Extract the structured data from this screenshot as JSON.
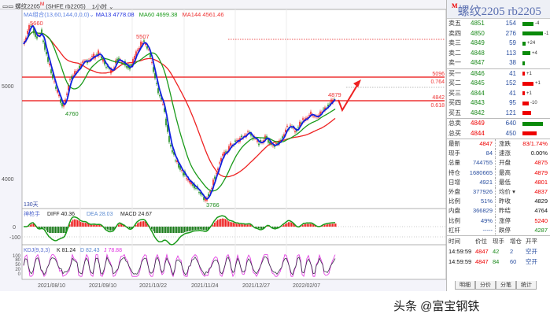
{
  "title_bar": {
    "symbol": "螺纹2205",
    "flag": "M",
    "code": "(SHFE rb2205)",
    "period": "1小时"
  },
  "main_legend": {
    "label": "MA组合(13,60,144,0,0,0)",
    "ma13": "MA13 4778.08",
    "ma60": "MA60 4699.38",
    "ma144": "MA144 4561.46"
  },
  "annotations": {
    "high1": "5660",
    "high2": "5507",
    "low1": "4760",
    "low2": "3766",
    "last_high": "4879",
    "level1": "5096",
    "ratio1": "0.764",
    "level2": "4842",
    "ratio2": "0.618",
    "days": "130天"
  },
  "price_axis": [
    "5000",
    "4000"
  ],
  "price_path": [
    [
      0,
      5450
    ],
    [
      6,
      5620
    ],
    [
      10,
      5660
    ],
    [
      16,
      5520
    ],
    [
      22,
      5580
    ],
    [
      30,
      5300
    ],
    [
      40,
      5000
    ],
    [
      50,
      4760
    ],
    [
      58,
      5050
    ],
    [
      70,
      5200
    ],
    [
      82,
      5280
    ],
    [
      95,
      5350
    ],
    [
      110,
      5150
    ],
    [
      120,
      5300
    ],
    [
      135,
      5200
    ],
    [
      145,
      5380
    ],
    [
      152,
      5507
    ],
    [
      160,
      5350
    ],
    [
      170,
      4950
    ],
    [
      178,
      4750
    ],
    [
      186,
      4350
    ],
    [
      194,
      4180
    ],
    [
      204,
      4050
    ],
    [
      212,
      3950
    ],
    [
      222,
      3880
    ],
    [
      232,
      3766
    ],
    [
      240,
      3950
    ],
    [
      250,
      4200
    ],
    [
      262,
      4350
    ],
    [
      274,
      4420
    ],
    [
      286,
      4500
    ],
    [
      298,
      4380
    ],
    [
      308,
      4440
    ],
    [
      318,
      4350
    ],
    [
      326,
      4420
    ],
    [
      336,
      4560
    ],
    [
      346,
      4520
    ],
    [
      356,
      4650
    ],
    [
      366,
      4700
    ],
    [
      374,
      4680
    ],
    [
      384,
      4760
    ],
    [
      390,
      4820
    ],
    [
      396,
      4879
    ]
  ],
  "macd_legend": {
    "label": "神枪手",
    "diff": "DIFF 40.36",
    "dea": "DEA 28.03",
    "macd": "MACD 24.67",
    "axis": [
      "0",
      "-100"
    ]
  },
  "kdj_legend": {
    "label": "KDJ(9,3,3)",
    "k": "K 81.24",
    "d": "D 82.43",
    "j": "J 78.88",
    "axis": [
      "100",
      "80",
      "50",
      "20",
      "0"
    ]
  },
  "dates": [
    "2021/08/10",
    "2021/09/10",
    "2021/10/22",
    "2021/11/24",
    "2021/12/27",
    "2022/02/07"
  ],
  "quote": {
    "name": "螺纹2205",
    "code": "rb2205",
    "flag": "M",
    "asks": [
      {
        "l": "卖五",
        "p": "4851",
        "v": "154",
        "c": "-4",
        "w": 14
      },
      {
        "l": "卖四",
        "p": "4850",
        "v": "276",
        "c": "-1",
        "w": 26
      },
      {
        "l": "卖三",
        "p": "4849",
        "v": "59",
        "c": "+24",
        "w": 4
      },
      {
        "l": "卖二",
        "p": "4848",
        "v": "113",
        "c": "+4",
        "w": 10
      },
      {
        "l": "卖一",
        "p": "4847",
        "v": "38",
        "c": "",
        "w": 3
      }
    ],
    "bids": [
      {
        "l": "买一",
        "p": "4846",
        "v": "41",
        "c": "+1",
        "w": 3
      },
      {
        "l": "买二",
        "p": "4845",
        "v": "152",
        "c": "+1",
        "w": 14
      },
      {
        "l": "买三",
        "p": "4844",
        "v": "41",
        "c": "+1",
        "w": 3
      },
      {
        "l": "买四",
        "p": "4843",
        "v": "95",
        "c": "-10",
        "w": 8
      },
      {
        "l": "买五",
        "p": "4842",
        "v": "121",
        "c": "",
        "w": 11
      }
    ],
    "totals": [
      {
        "l": "总卖",
        "p": "4849",
        "v": "640",
        "w": 26,
        "col": "#0a8a0a"
      },
      {
        "l": "总买",
        "p": "4844",
        "v": "450",
        "w": 18,
        "col": "#e00"
      }
    ],
    "stats": [
      [
        "最新",
        "4847",
        "涨跌",
        "83/1.74%",
        "red",
        "red"
      ],
      [
        "现手",
        "84",
        "速涨",
        "0.00%",
        "blu",
        "blk"
      ],
      [
        "总量",
        "744755",
        "开盘",
        "4875",
        "blu",
        "red"
      ],
      [
        "持仓",
        "1680665",
        "最高",
        "4879",
        "blu",
        "red"
      ],
      [
        "日增",
        "4921",
        "最低",
        "4801",
        "blu",
        "red"
      ],
      [
        "外盘",
        "377926",
        "均价 ▾",
        "4837",
        "blu",
        "red"
      ],
      [
        "比例",
        "51%",
        "昨收",
        "4829",
        "blu",
        "blk"
      ],
      [
        "内盘",
        "366829",
        "昨结",
        "4764",
        "blu",
        "blk"
      ],
      [
        "比例",
        "49%",
        "涨停",
        "5240",
        "blu",
        "red"
      ],
      [
        "杠杆",
        "-----",
        "跌停",
        "4287",
        "blu",
        "grn"
      ]
    ],
    "ticks_header": [
      "时间",
      "价位",
      "现手",
      "增仓",
      "开平"
    ],
    "ticks": [
      [
        "14:59:59",
        "4847",
        "42",
        "2",
        "空开"
      ],
      [
        "14:59:59",
        "4847",
        "84",
        "60",
        "空开"
      ]
    ],
    "tabs": [
      "明细",
      "分价",
      "分笔",
      "统计"
    ]
  },
  "watermark": "头条 @富宝钢铁"
}
